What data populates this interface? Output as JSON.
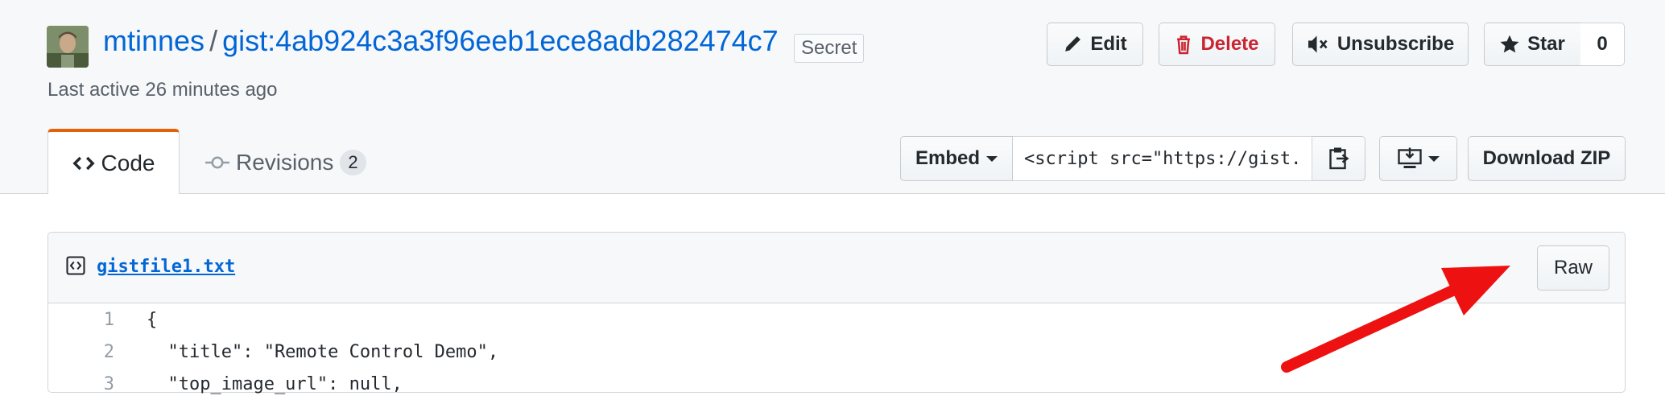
{
  "header": {
    "owner": "mtinnes",
    "separator": "/",
    "gist_name": "gist:4ab924c3a3f96eeb1ece8adb282474c7",
    "visibility_badge": "Secret",
    "last_active": "Last active 26 minutes ago"
  },
  "actions": {
    "edit": "Edit",
    "delete": "Delete",
    "unsubscribe": "Unsubscribe",
    "star": "Star",
    "star_count": "0"
  },
  "tabs": [
    {
      "label": "Code",
      "active": true
    },
    {
      "label": "Revisions",
      "count": "2",
      "active": false
    }
  ],
  "embed": {
    "button_label": "Embed",
    "value": "<script src=\"https://gist."
  },
  "download_zip": "Download ZIP",
  "file": {
    "name": "gistfile1.txt",
    "raw_label": "Raw",
    "lines": [
      {
        "number": "1",
        "text": "{"
      },
      {
        "number": "2",
        "text": "  \"title\": \"Remote Control Demo\","
      },
      {
        "number": "3",
        "text": "  \"top_image_url\": null,"
      }
    ]
  },
  "colors": {
    "link": "#0366d6",
    "danger": "#cb2431",
    "tab_accent": "#e36209",
    "annotation_arrow": "#ee1111"
  }
}
